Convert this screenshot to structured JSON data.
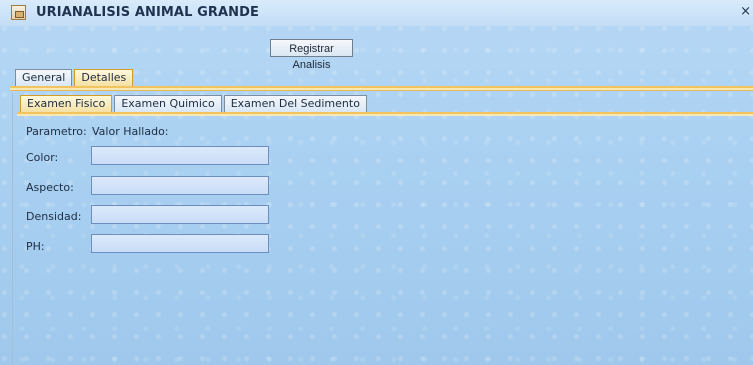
{
  "window": {
    "title": "URIANALISIS ANIMAL GRANDE",
    "close_symbol": "×",
    "app_icon": "application-icon"
  },
  "actions": {
    "register_label": "Registrar Analisis"
  },
  "main_tabs": [
    {
      "label": "General",
      "active": false
    },
    {
      "label": "Detalles",
      "active": true
    }
  ],
  "sub_tabs": [
    {
      "label": "Examen Fisico",
      "active": true
    },
    {
      "label": "Examen Quimico",
      "active": false
    },
    {
      "label": "Examen Del Sedimento",
      "active": false
    }
  ],
  "form": {
    "parameter_header": "Parametro:",
    "value_header": "Valor Hallado:",
    "rows": [
      {
        "label": "Color:",
        "value": ""
      },
      {
        "label": "Aspecto:",
        "value": ""
      },
      {
        "label": "Densidad:",
        "value": ""
      },
      {
        "label": "PH:",
        "value": ""
      }
    ]
  }
}
